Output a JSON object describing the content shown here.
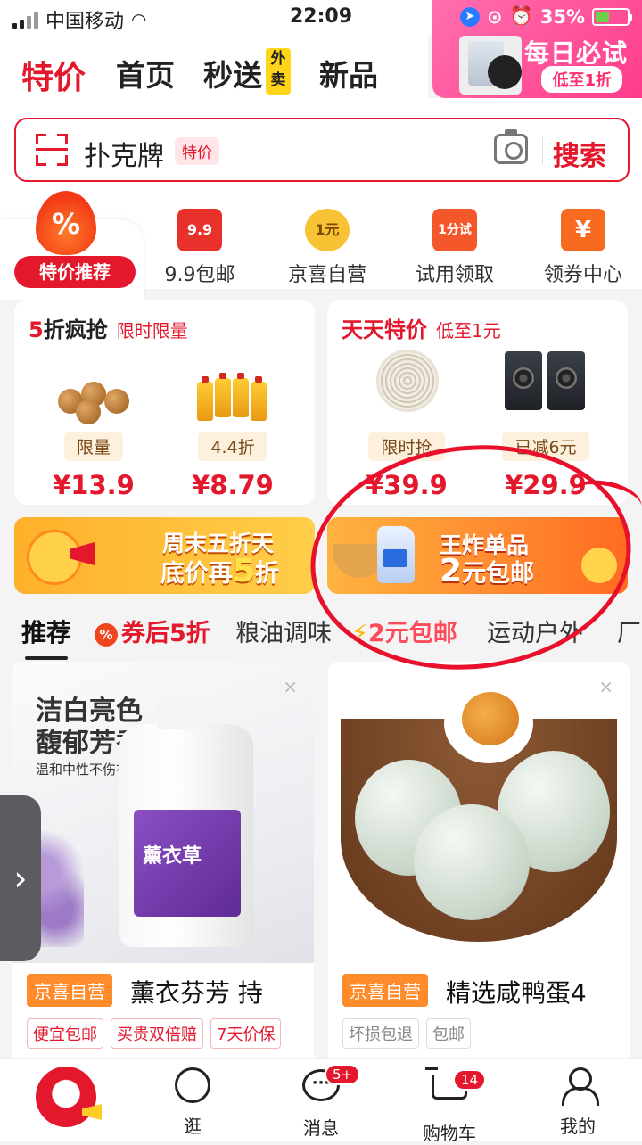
{
  "status_bar": {
    "carrier": "中国移动",
    "time": "22:09",
    "battery": "35%"
  },
  "promo_corner": {
    "title": "每日必试",
    "subtitle": "低至1折"
  },
  "top_tabs": [
    {
      "label": "特价",
      "active": true
    },
    {
      "label": "首页"
    },
    {
      "label": "秒送"
    },
    {
      "label": "新品"
    }
  ],
  "takeout_badge": "外卖",
  "search": {
    "query": "扑克牌",
    "tag": "特价",
    "button": "搜索"
  },
  "categories": {
    "active": {
      "label": "特价推荐"
    },
    "items": [
      {
        "label": "9.9包邮",
        "icon_text": "9.9",
        "color": "#e8312a"
      },
      {
        "label": "京喜自营",
        "icon_text": "1元",
        "color": "#f7c233"
      },
      {
        "label": "试用领取",
        "icon_text": "1分试",
        "color": "#f4582a"
      },
      {
        "label": "领券中心",
        "icon_text": "¥",
        "color": "#f76a1f"
      }
    ]
  },
  "deal_cards": [
    {
      "title_prefix": "5",
      "title": "折疯抢",
      "subtitle": "限时限量",
      "products": [
        {
          "tag": "限量",
          "price": "¥13.9"
        },
        {
          "tag": "4.4折",
          "price": "¥8.79"
        }
      ]
    },
    {
      "title": "天天特价",
      "subtitle": "低至1元",
      "products": [
        {
          "tag": "限时抢",
          "price": "¥39.9"
        },
        {
          "tag": "已减6元",
          "price": "¥29.9"
        }
      ]
    }
  ],
  "banners": {
    "left": {
      "line1": "周末五折天",
      "line2_pre": "底价再",
      "line2_big": "5",
      "line2_post": "折"
    },
    "right": {
      "line1": "王炸单品",
      "line2_big": "2",
      "line2_post": "元包邮"
    }
  },
  "feed_tabs": [
    {
      "label": "推荐",
      "active": true
    },
    {
      "label": "券后5折",
      "icon": "%"
    },
    {
      "label": "粮油调味"
    },
    {
      "label": "2元包邮",
      "icon": "⚡"
    },
    {
      "label": "运动户外"
    },
    {
      "label": "厂"
    }
  ],
  "product_feed": [
    {
      "headline": "洁白亮色",
      "headline2": "馥郁芳香",
      "tagline": "温和中性不伤衣",
      "jug_label": "薰衣草",
      "brand": "京喜自营",
      "name": "薰衣芬芳 持",
      "chips": [
        "便宜包邮",
        "买贵双倍赔",
        "7天价保"
      ]
    },
    {
      "brand": "京喜自营",
      "name": "精选咸鸭蛋4",
      "chips": [
        "坏损包退",
        "包邮"
      ]
    }
  ],
  "bottom_nav": {
    "items": [
      {
        "label": "逛"
      },
      {
        "label": "消息",
        "badge": "5+"
      },
      {
        "label": "购物车",
        "badge": "14"
      },
      {
        "label": "我的"
      }
    ]
  },
  "close_glyph": "×",
  "side_arrow": "›"
}
